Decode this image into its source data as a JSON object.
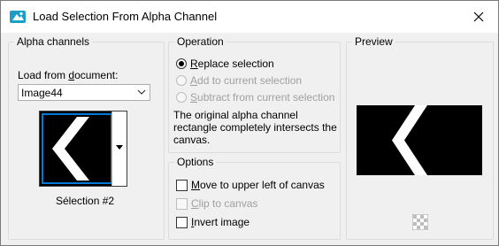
{
  "window": {
    "title": "Load Selection From Alpha Channel",
    "close_symbol": "✕"
  },
  "alpha": {
    "group_title": "Alpha channels",
    "load_label_pre": "Load from ",
    "load_label_u": "d",
    "load_label_post": "ocument:",
    "document_value": "Image44",
    "selection_name": "Sélection #2"
  },
  "operation": {
    "group_title": "Operation",
    "options": [
      {
        "u": "R",
        "rest": "eplace selection",
        "checked": true,
        "disabled": false
      },
      {
        "u": "A",
        "rest": "dd to current selection",
        "checked": false,
        "disabled": true
      },
      {
        "u": "S",
        "rest": "ubtract from current selection",
        "checked": false,
        "disabled": true
      }
    ],
    "description": "The original alpha channel rectangle completely intersects the canvas."
  },
  "options": {
    "group_title": "Options",
    "items": [
      {
        "u": "M",
        "rest": "ove to upper left of canvas",
        "checked": false,
        "disabled": false
      },
      {
        "u": "C",
        "rest": "lip to canvas",
        "checked": false,
        "disabled": true
      },
      {
        "u": "I",
        "rest": "nvert image",
        "checked": false,
        "disabled": false
      }
    ]
  },
  "preview": {
    "group_title": "Preview"
  },
  "colors": {
    "accent": "#0078d7",
    "disabled_text": "#a0a0a0",
    "app_icon": "#1aa0c8"
  }
}
